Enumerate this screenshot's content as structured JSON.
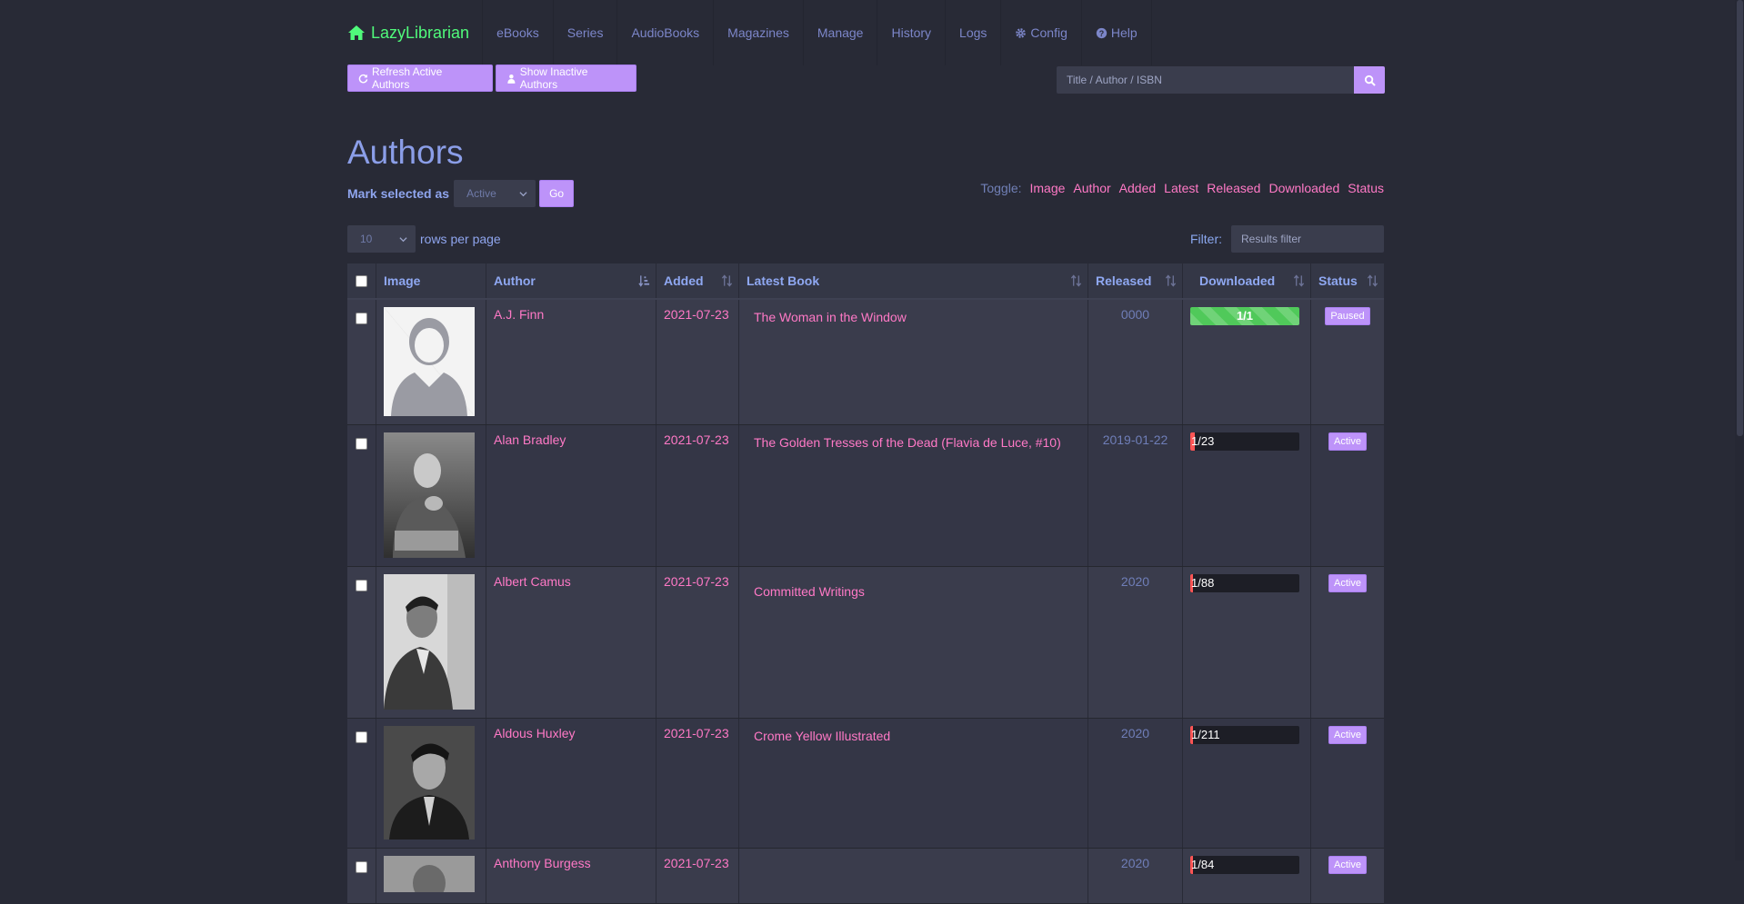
{
  "app": {
    "name": "LazyLibrarian"
  },
  "nav": [
    {
      "label": "eBooks"
    },
    {
      "label": "Series"
    },
    {
      "label": "AudioBooks"
    },
    {
      "label": "Magazines"
    },
    {
      "label": "Manage"
    },
    {
      "label": "History"
    },
    {
      "label": "Logs"
    },
    {
      "label": "Config",
      "icon": "gear-icon"
    },
    {
      "label": "Help",
      "icon": "question-circle-icon"
    }
  ],
  "toolbar": {
    "refresh_label": "Refresh Active Authors",
    "inactive_label": "Show Inactive Authors"
  },
  "search": {
    "placeholder": "Title / Author / ISBN"
  },
  "page_title": "Authors",
  "mark": {
    "label": "Mark selected as",
    "selected": "Active",
    "go": "Go"
  },
  "toggle": {
    "label": "Toggle:",
    "links": [
      "Image",
      "Author",
      "Added",
      "Latest",
      "Released",
      "Downloaded",
      "Status"
    ]
  },
  "rows_per_page": {
    "selected": "10",
    "label": "rows per page"
  },
  "filter": {
    "label": "Filter:",
    "placeholder": "Results filter"
  },
  "table": {
    "headers": {
      "image": "Image",
      "author": "Author",
      "added": "Added",
      "latest": "Latest Book",
      "released": "Released",
      "downloaded": "Downloaded",
      "status": "Status"
    },
    "rows": [
      {
        "author": "A.J. Finn",
        "added": "2021-07-23",
        "latest": "The Woman in the Window",
        "released": "0000",
        "downloaded": "1/1",
        "have": 1,
        "total": 1,
        "status": "Paused"
      },
      {
        "author": "Alan Bradley",
        "added": "2021-07-23",
        "latest": "The Golden Tresses of the Dead (Flavia de Luce, #10)",
        "released": "2019-01-22",
        "downloaded": "1/23",
        "have": 1,
        "total": 23,
        "status": "Active"
      },
      {
        "author": "Albert Camus",
        "added": "2021-07-23",
        "latest": "Committed Writings",
        "released": "2020",
        "downloaded": "1/88",
        "have": 1,
        "total": 88,
        "status": "Active"
      },
      {
        "author": "Aldous Huxley",
        "added": "2021-07-23",
        "latest": "Crome Yellow Illustrated",
        "released": "2020",
        "downloaded": "1/211",
        "have": 1,
        "total": 211,
        "status": "Active"
      },
      {
        "author": "Anthony Burgess",
        "added": "2021-07-23",
        "latest": "",
        "released": "2020",
        "downloaded": "1/84",
        "have": 1,
        "total": 84,
        "status": "Active"
      }
    ]
  },
  "colors": {
    "background": "#282a36",
    "accent": "#bd93f9",
    "link": "#ff79c6",
    "brand": "#50fa7b",
    "progress_full": "#50c95a",
    "progress_low": "#ff5555"
  }
}
